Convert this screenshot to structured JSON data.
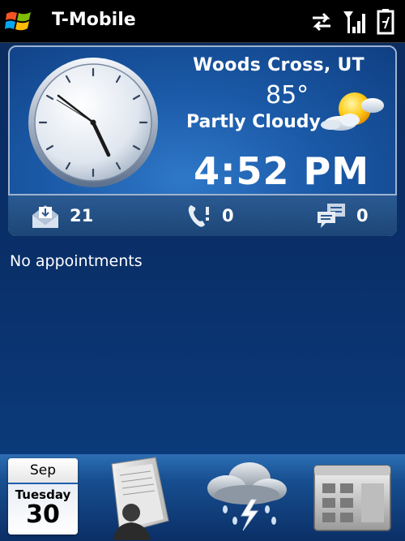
{
  "status_bar": {
    "carrier": "T-Mobile",
    "icons": [
      "windows-logo-icon",
      "data-transfer-icon",
      "signal-strength-icon",
      "battery-icon"
    ]
  },
  "home": {
    "weather": {
      "location": "Woods Cross, UT",
      "temperature": "85°",
      "condition": "Partly Cloudy",
      "icon": "partly-cloudy-icon"
    },
    "time": "4:52 PM",
    "notifications": {
      "email_count": "21",
      "missed_calls": "0",
      "messages": "0"
    },
    "appointments_text": "No appointments"
  },
  "dock": {
    "calendar": {
      "month": "Sep",
      "weekday": "Tuesday",
      "day": "30"
    },
    "items": [
      "contacts-icon",
      "weather-storm-icon",
      "programs-icon"
    ]
  },
  "colors": {
    "background": "#0b2a5a",
    "panel": "#1b5aa8",
    "accent_border": "#9fb3cf"
  }
}
